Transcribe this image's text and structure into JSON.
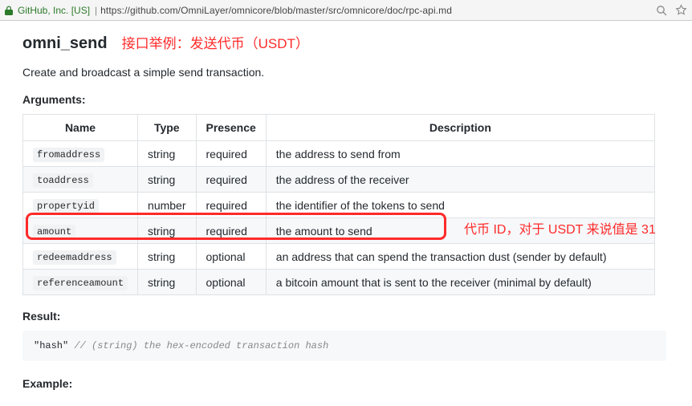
{
  "browser": {
    "site_label": "GitHub, Inc. [US]",
    "url": "https://github.com/OmniLayer/omnicore/blob/master/src/omnicore/doc/rpc-api.md"
  },
  "doc": {
    "title": "omni_send",
    "title_note": "接口举例：发送代币（USDT）",
    "description": "Create and broadcast a simple send transaction.",
    "arguments_heading": "Arguments:",
    "table_headers": {
      "name": "Name",
      "type": "Type",
      "presence": "Presence",
      "description": "Description"
    },
    "arguments": [
      {
        "name": "fromaddress",
        "type": "string",
        "presence": "required",
        "description": "the address to send from"
      },
      {
        "name": "toaddress",
        "type": "string",
        "presence": "required",
        "description": "the address of the receiver"
      },
      {
        "name": "propertyid",
        "type": "number",
        "presence": "required",
        "description": "the identifier of the tokens to send"
      },
      {
        "name": "amount",
        "type": "string",
        "presence": "required",
        "description": "the amount to send"
      },
      {
        "name": "redeemaddress",
        "type": "string",
        "presence": "optional",
        "description": "an address that can spend the transaction dust (sender by default)"
      },
      {
        "name": "referenceamount",
        "type": "string",
        "presence": "optional",
        "description": "a bitcoin amount that is sent to the receiver (minimal by default)"
      }
    ],
    "highlight_row_note": "代币 ID，对于 USDT 来说值是 31",
    "result_heading": "Result:",
    "result_code_str": "\"hash\"",
    "result_code_cmt": "  // (string) the hex-encoded transaction hash",
    "example_heading": "Example:"
  }
}
